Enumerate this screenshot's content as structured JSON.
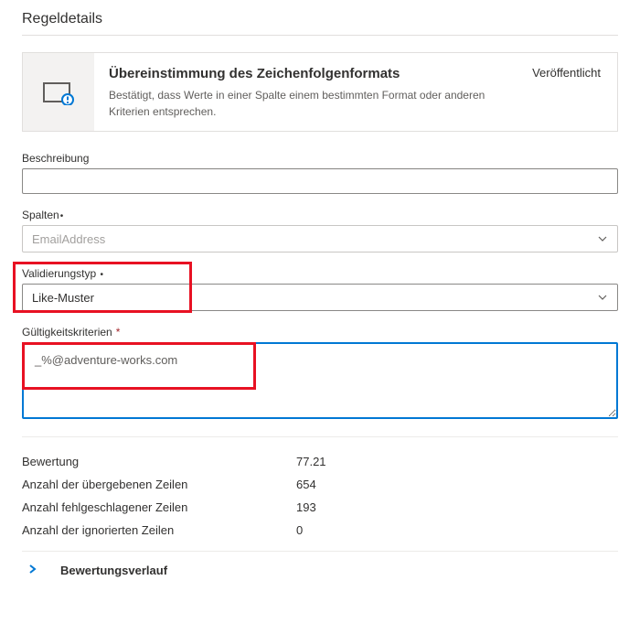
{
  "section_title": "Regeldetails",
  "card": {
    "title": "Übereinstimmung des Zeichenfolgenformats",
    "description": "Bestätigt, dass Werte in einer Spalte einem bestimmten Format oder anderen Kriterien entsprechen.",
    "status": "Veröffentlicht"
  },
  "fields": {
    "description": {
      "label": "Beschreibung",
      "value": ""
    },
    "columns": {
      "label": "Spalten",
      "value": "EmailAddress"
    },
    "validation_type": {
      "label": "Validierungstyp",
      "value": "Like-Muster"
    },
    "criteria": {
      "label": "Gültigkeitskriterien",
      "value": "_%@adventure-works.com"
    }
  },
  "metrics": {
    "score": {
      "label": "Bewertung",
      "value": "77.21"
    },
    "passed": {
      "label": "Anzahl der übergebenen Zeilen",
      "value": "654"
    },
    "failed": {
      "label": "Anzahl fehlgeschlagener Zeilen",
      "value": "193"
    },
    "ignored": {
      "label": "Anzahl der ignorierten Zeilen",
      "value": "0"
    }
  },
  "history_label": "Bewertungsverlauf"
}
